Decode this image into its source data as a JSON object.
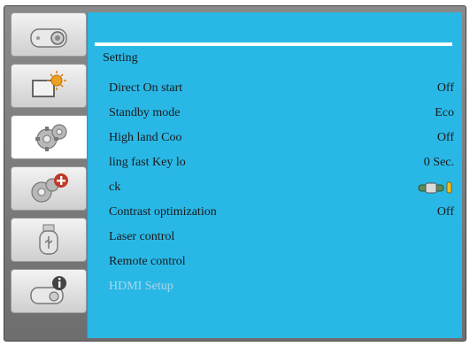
{
  "sidebar": {
    "tabs": [
      {
        "icon": "display-icon"
      },
      {
        "icon": "picture-icon"
      },
      {
        "icon": "settings-gears-icon",
        "active": true
      },
      {
        "icon": "expanded-setting-icon"
      },
      {
        "icon": "usb-icon"
      },
      {
        "icon": "info-icon"
      }
    ]
  },
  "menu": {
    "title": "Setting",
    "rows": [
      {
        "label": "Direct On start",
        "value": "Off"
      },
      {
        "label": "Standby mode",
        "value": "Eco"
      },
      {
        "label": "High land  Coo",
        "value": "Off"
      },
      {
        "label": "ling fast  Key lo",
        "value": "0 Sec."
      },
      {
        "label": "ck",
        "value": "",
        "icon": "slider-icon"
      },
      {
        "label": "Contrast optimization",
        "value": "Off"
      },
      {
        "label": "Laser control",
        "value": ""
      },
      {
        "label": "Remote control",
        "value": ""
      },
      {
        "label": "HDMI Setup",
        "value": "",
        "disabled": true
      }
    ]
  },
  "colors": {
    "panel": "#29b8e6",
    "frame": "#7a7a7a",
    "disabled_text": "#a8d8ea"
  }
}
